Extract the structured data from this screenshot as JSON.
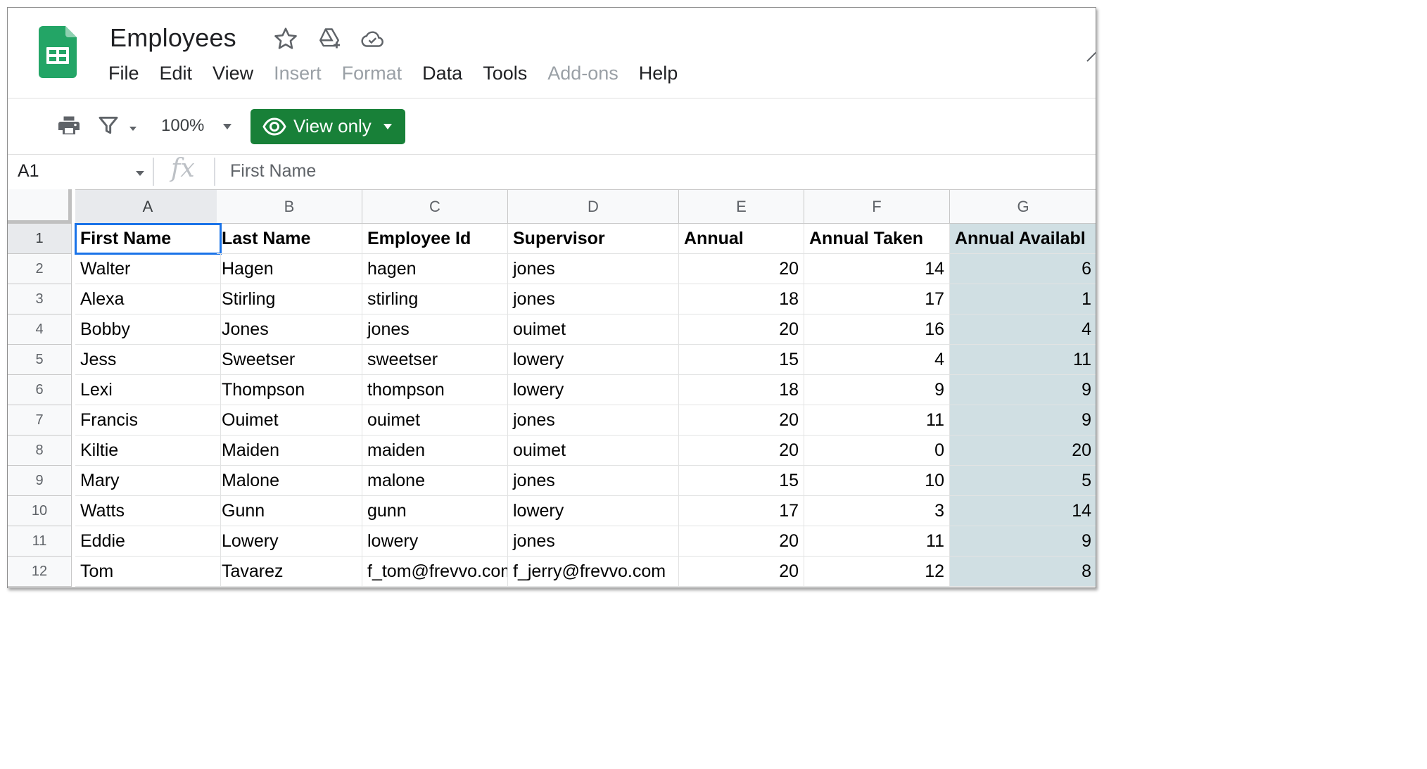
{
  "doc": {
    "title": "Employees",
    "icons": [
      "star-icon",
      "move-to-drive-icon",
      "cloud-status-icon"
    ]
  },
  "menu": [
    {
      "label": "File",
      "enabled": true
    },
    {
      "label": "Edit",
      "enabled": true
    },
    {
      "label": "View",
      "enabled": true
    },
    {
      "label": "Insert",
      "enabled": false
    },
    {
      "label": "Format",
      "enabled": false
    },
    {
      "label": "Data",
      "enabled": true
    },
    {
      "label": "Tools",
      "enabled": true
    },
    {
      "label": "Add-ons",
      "enabled": false
    },
    {
      "label": "Help",
      "enabled": true
    }
  ],
  "toolbar": {
    "zoom": "100%",
    "view_only_label": "View only",
    "icons": [
      "print-icon",
      "filter-icon"
    ]
  },
  "formula_bar": {
    "name_box": "A1",
    "fx_label": "fx",
    "formula": "First Name"
  },
  "colors": {
    "brand_green": "#188038",
    "selection_blue": "#1a73e8",
    "shaded_column": "#d0dfe3"
  },
  "grid": {
    "columns": [
      "A",
      "B",
      "C",
      "D",
      "E",
      "F",
      "G"
    ],
    "selected_column": "A",
    "active_cell": "A1",
    "shaded_column": "G",
    "rows": [
      {
        "n": "1",
        "cells": [
          "First Name",
          "Last Name",
          "Employee Id",
          "Supervisor",
          "Annual",
          "Annual Taken",
          "Annual Availabl"
        ]
      },
      {
        "n": "2",
        "cells": [
          "Walter",
          "Hagen",
          "hagen",
          "jones",
          "20",
          "14",
          "6"
        ]
      },
      {
        "n": "3",
        "cells": [
          "Alexa",
          "Stirling",
          "stirling",
          "jones",
          "18",
          "17",
          "1"
        ]
      },
      {
        "n": "4",
        "cells": [
          "Bobby",
          "Jones",
          "jones",
          "ouimet",
          "20",
          "16",
          "4"
        ]
      },
      {
        "n": "5",
        "cells": [
          "Jess",
          "Sweetser",
          "sweetser",
          "lowery",
          "15",
          "4",
          "11"
        ]
      },
      {
        "n": "6",
        "cells": [
          "Lexi",
          "Thompson",
          "thompson",
          "lowery",
          "18",
          "9",
          "9"
        ]
      },
      {
        "n": "7",
        "cells": [
          "Francis",
          "Ouimet",
          "ouimet",
          "jones",
          "20",
          "11",
          "9"
        ]
      },
      {
        "n": "8",
        "cells": [
          "Kiltie",
          "Maiden",
          "maiden",
          "ouimet",
          "20",
          "0",
          "20"
        ]
      },
      {
        "n": "9",
        "cells": [
          "Mary",
          "Malone",
          "malone",
          "jones",
          "15",
          "10",
          "5"
        ]
      },
      {
        "n": "10",
        "cells": [
          "Watts",
          "Gunn",
          "gunn",
          "lowery",
          "17",
          "3",
          "14"
        ]
      },
      {
        "n": "11",
        "cells": [
          "Eddie",
          "Lowery",
          "lowery",
          "jones",
          "20",
          "11",
          "9"
        ]
      },
      {
        "n": "12",
        "cells": [
          "Tom",
          "Tavarez",
          "f_tom@frevvo.com",
          "f_jerry@frevvo.com",
          "20",
          "12",
          "8"
        ]
      }
    ]
  }
}
